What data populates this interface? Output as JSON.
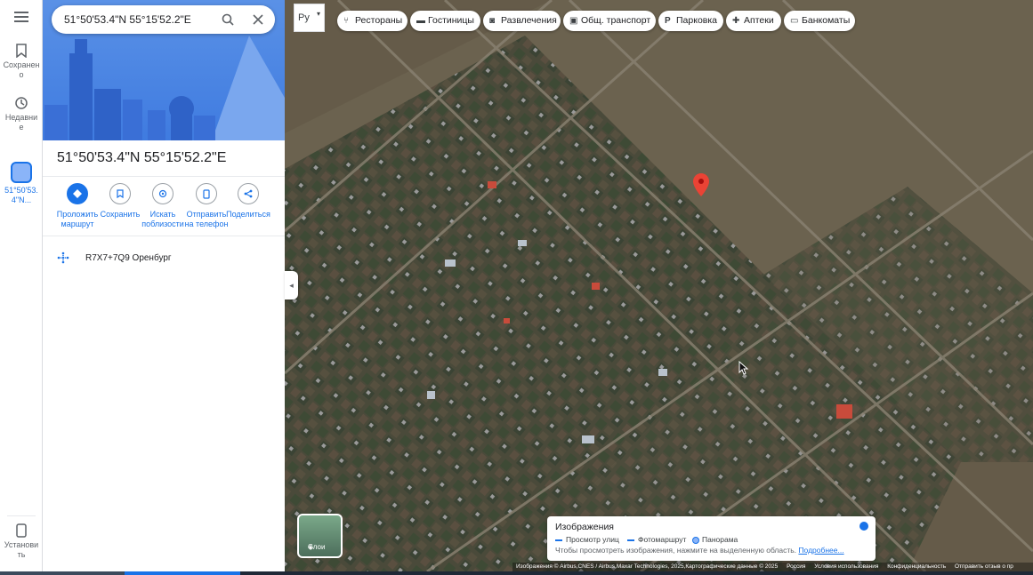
{
  "search": {
    "value": "51°50'53.4\"N 55°15'52.2\"E"
  },
  "rail": {
    "saved": "Сохранено",
    "recent": "Недавние",
    "current": "51°50'53.4\"N...",
    "install": "Установить"
  },
  "place": {
    "title": "51°50'53.4\"N 55°15'52.2\"E",
    "plus_code": "R7X7+7Q9 Оренбург"
  },
  "actions": [
    {
      "label": "Проложить маршрут",
      "icon": "directions-icon"
    },
    {
      "label": "Сохранить",
      "icon": "bookmark-icon"
    },
    {
      "label": "Искать поблизости",
      "icon": "nearby-icon"
    },
    {
      "label": "Отправить на телефон",
      "icon": "send-to-phone-icon"
    },
    {
      "label": "Поделиться",
      "icon": "share-icon"
    }
  ],
  "language": "Ру",
  "chips": [
    {
      "label": "Рестораны",
      "icon": "restaurant-icon"
    },
    {
      "label": "Гостиницы",
      "icon": "hotel-icon"
    },
    {
      "label": "Развлечения",
      "icon": "camera-icon"
    },
    {
      "label": "Общ. транспорт",
      "icon": "transit-icon"
    },
    {
      "label": "Парковка",
      "icon": "parking-icon"
    },
    {
      "label": "Аптеки",
      "icon": "pharmacy-icon"
    },
    {
      "label": "Банкоматы",
      "icon": "atm-icon"
    }
  ],
  "layers": {
    "label": "Слои"
  },
  "imagery": {
    "title": "Изображения",
    "legend": [
      "Просмотр улиц",
      "Фотомаршрут",
      "Панорама"
    ],
    "hint": "Чтобы просмотреть изображения, нажмите на выделенную область.",
    "more": "Подробнее..."
  },
  "attribution": [
    "Изображения © Airbus,CNES / Airbus,Maxar Technologies, 2025,Картографические данные © 2025",
    "Россия",
    "Условия использования",
    "Конфиденциальность",
    "Отправить отзыв о пр"
  ],
  "colors": {
    "accent": "#1a73e8",
    "pin": "#ea4335",
    "map": "#5b5445"
  }
}
